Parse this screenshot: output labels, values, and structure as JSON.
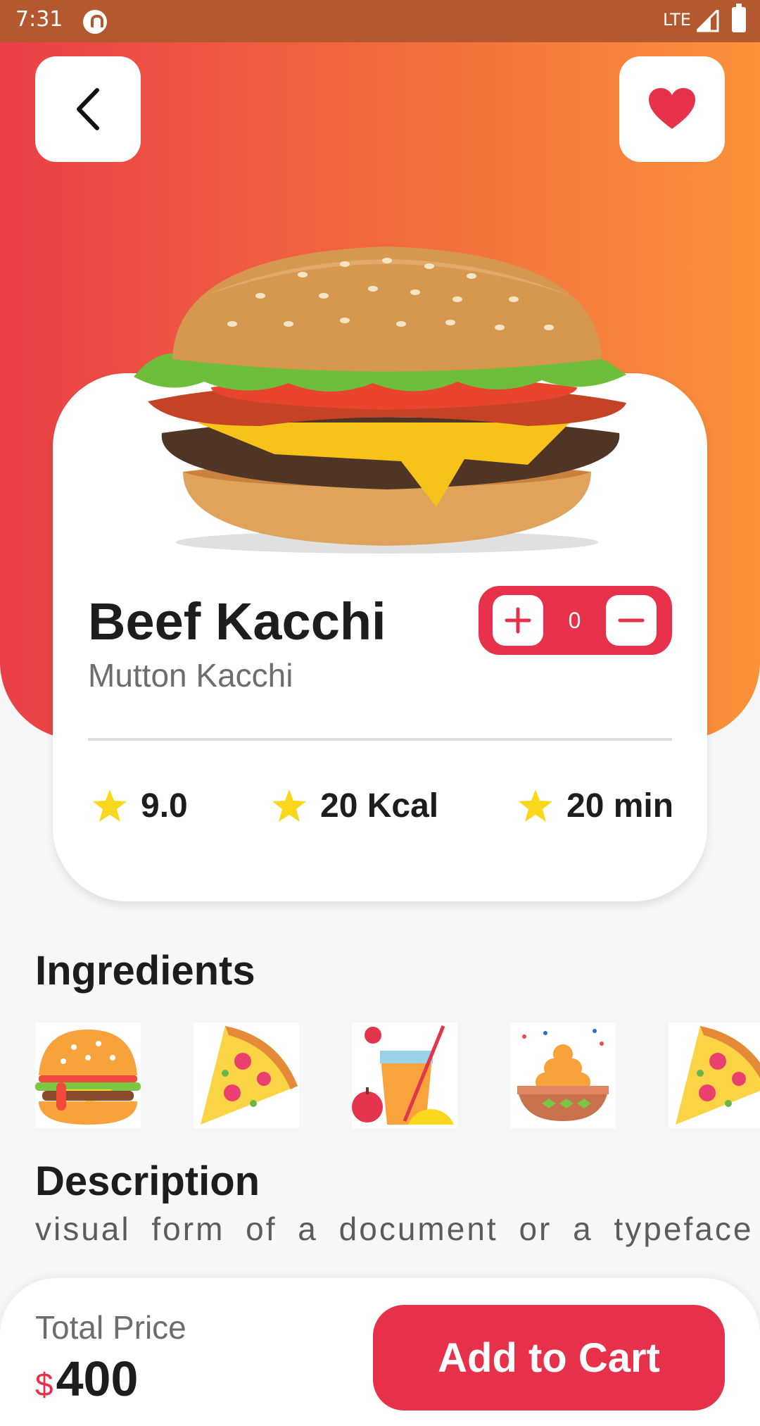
{
  "status_bar": {
    "time": "7:31",
    "network": "LTE"
  },
  "header": {
    "back_icon": "chevron-left-icon",
    "favorite_icon": "heart-icon"
  },
  "colors": {
    "accent": "#e7314a",
    "gradient_start": "#ea4048",
    "gradient_end": "#fa923a",
    "star": "#f9d71c"
  },
  "product": {
    "name": "Beef Kacchi",
    "subtitle": "Mutton Kacchi",
    "image": "burger-image",
    "quantity": "0"
  },
  "stats": [
    {
      "icon": "star-icon",
      "value": "9.0"
    },
    {
      "icon": "star-icon",
      "value": "20 Kcal"
    },
    {
      "icon": "star-icon",
      "value": "20 min"
    }
  ],
  "ingredients": {
    "title": "Ingredients",
    "items": [
      "burger-icon",
      "pizza-icon",
      "juice-icon",
      "sweets-bowl-icon",
      "pizza-icon"
    ]
  },
  "description": {
    "title": "Description",
    "text": "visual form of a document or a typeface"
  },
  "footer": {
    "total_label": "Total Price",
    "currency": "$",
    "price": "400",
    "cart_label": "Add to Cart"
  }
}
